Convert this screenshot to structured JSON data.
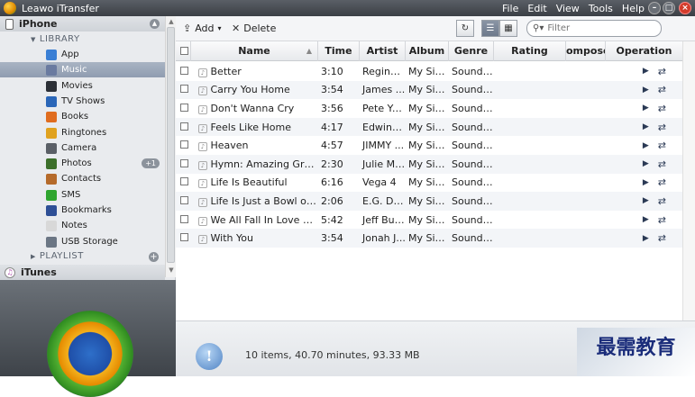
{
  "window": {
    "title": "Leawo iTransfer"
  },
  "menu": [
    "File",
    "Edit",
    "View",
    "Tools",
    "Help"
  ],
  "sidebar": {
    "device": "iPhone",
    "library_label": "LIBRARY",
    "items": [
      {
        "label": "App",
        "icon": "app-icon",
        "color": "#3a7fd5"
      },
      {
        "label": "Music",
        "icon": "music-icon",
        "color": "#6a7ba0"
      },
      {
        "label": "Movies",
        "icon": "movies-icon",
        "color": "#2b2f36"
      },
      {
        "label": "TV Shows",
        "icon": "tv-icon",
        "color": "#2a66b8"
      },
      {
        "label": "Books",
        "icon": "books-icon",
        "color": "#e06c1f"
      },
      {
        "label": "Ringtones",
        "icon": "ringtones-icon",
        "color": "#e0a21f"
      },
      {
        "label": "Camera",
        "icon": "camera-icon",
        "color": "#5a5f66"
      },
      {
        "label": "Photos",
        "icon": "photos-icon",
        "color": "#3c6f2a",
        "badge": "+1"
      },
      {
        "label": "Contacts",
        "icon": "contacts-icon",
        "color": "#b56a2a"
      },
      {
        "label": "SMS",
        "icon": "sms-icon",
        "color": "#2fa52f"
      },
      {
        "label": "Bookmarks",
        "icon": "bookmarks-icon",
        "color": "#2e4f96"
      },
      {
        "label": "Notes",
        "icon": "notes-icon",
        "color": "#d8d8d8"
      },
      {
        "label": "USB Storage",
        "icon": "usb-storage-icon",
        "color": "#6b7684"
      }
    ],
    "playlist_label": "PLAYLIST",
    "itunes_label": "iTunes"
  },
  "toolbar": {
    "add_label": "Add",
    "delete_label": "Delete",
    "search_placeholder": "Filter"
  },
  "table": {
    "headers": [
      "Name",
      "Time",
      "Artist",
      "Album",
      "Genre",
      "Rating",
      "ompose",
      "Operation"
    ],
    "rows": [
      {
        "name": "Better",
        "time": "3:10",
        "artist": "Regina ...",
        "album": "My Sist...",
        "genre": "Soundt..."
      },
      {
        "name": "Carry You Home",
        "time": "3:54",
        "artist": "James ...",
        "album": "My Sist...",
        "genre": "Soundt..."
      },
      {
        "name": "Don't Wanna Cry",
        "time": "3:56",
        "artist": "Pete Yo...",
        "album": "My Sist...",
        "genre": "Soundt..."
      },
      {
        "name": "Feels Like Home",
        "time": "4:17",
        "artist": "Edwina...",
        "album": "My Sist...",
        "genre": "Soundt..."
      },
      {
        "name": "Heaven",
        "time": "4:57",
        "artist": "JIMMY ...",
        "album": "My Sist...",
        "genre": "Soundt..."
      },
      {
        "name": "Hymn: Amazing Grace",
        "time": "2:30",
        "artist": "Julie Mc...",
        "album": "My Sist...",
        "genre": "Soundt..."
      },
      {
        "name": "Life Is Beautiful",
        "time": "6:16",
        "artist": "Vega 4",
        "album": "My Sist...",
        "genre": "Soundt..."
      },
      {
        "name": "Life Is Just a Bowl of C...",
        "time": "2:06",
        "artist": "E.G. Da...",
        "album": "My Sist...",
        "genre": "Soundt..."
      },
      {
        "name": "We All Fall In Love So...",
        "time": "5:42",
        "artist": "Jeff Buc...",
        "album": "My Sist...",
        "genre": "Soundt..."
      },
      {
        "name": "With You",
        "time": "3:54",
        "artist": "Jonah J...",
        "album": "My Sist...",
        "genre": "Soundt..."
      }
    ]
  },
  "status": {
    "text": "10 items, 40.70 minutes, 93.33 MB"
  },
  "watermark": "最需教育"
}
